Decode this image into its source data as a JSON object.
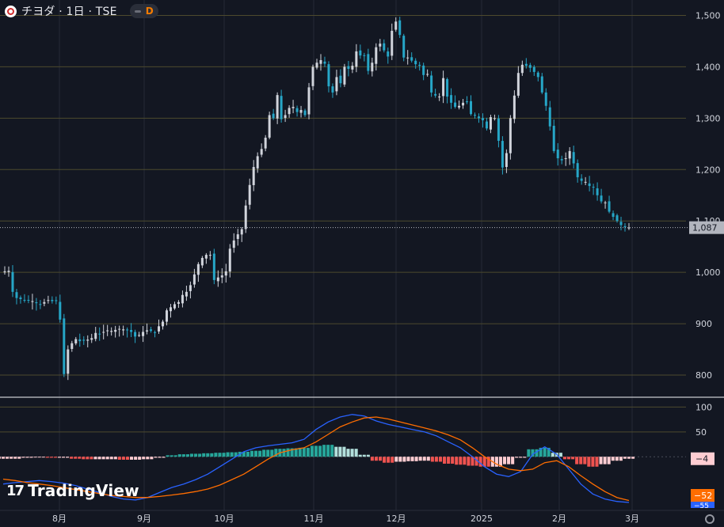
{
  "header": {
    "title": "チヨダ · 1日 · TSE",
    "interval_badge": "D"
  },
  "brand": {
    "mark": "17",
    "text": "TradingView"
  },
  "colors": {
    "background": "#131722",
    "grid": "#363a45",
    "gold_grid": "#4d4a2e",
    "up": "#d1d4dc",
    "down": "#26a6c7",
    "macd_line": "#2962ff",
    "signal_line": "#ff6d00",
    "hist_pos": "#26a69a",
    "hist_pos_light": "#b2dfdb",
    "hist_neg": "#ef5350",
    "hist_neg_light": "#ffcdd2",
    "last_price_tag": "#b2b5be",
    "macd_tag": "#f23645",
    "signal_tag": "#ff6d00"
  },
  "chart_data": {
    "type": "candlestick",
    "symbol": "チヨダ",
    "interval": "1日",
    "exchange": "TSE",
    "price_axis": {
      "ticks": [
        800,
        900,
        1000,
        1100,
        1200,
        1300,
        1400,
        1500
      ],
      "tick_labels": [
        "800",
        "900",
        "1,000",
        "1,100",
        "1,200",
        "1,300",
        "1,400",
        "1,500"
      ],
      "range": [
        760,
        1530
      ]
    },
    "time_axis": {
      "labels": [
        "8月",
        "9月",
        "10月",
        "11月",
        "12月",
        "2025",
        "2月",
        "3月"
      ]
    },
    "last_price": 1087,
    "last_price_label": "1,087",
    "candles_close": [
      1002,
      1003,
      962,
      950,
      948,
      946,
      945,
      944,
      940,
      938,
      942,
      946,
      944,
      945,
      908,
      802,
      850,
      862,
      870,
      866,
      867,
      869,
      872,
      882,
      880,
      884,
      887,
      886,
      888,
      890,
      889,
      888,
      884,
      875,
      878,
      884,
      887,
      886,
      883,
      895,
      904,
      926,
      932,
      938,
      942,
      956,
      962,
      975,
      996,
      1016,
      1028,
      1034,
      1034,
      985,
      990,
      994,
      1002,
      1046,
      1062,
      1074,
      1084,
      1130,
      1170,
      1205,
      1226,
      1240,
      1262,
      1306,
      1300,
      1345,
      1298,
      1306,
      1320,
      1322,
      1312,
      1316,
      1306,
      1360,
      1400,
      1408,
      1413,
      1406,
      1362,
      1350,
      1380,
      1368,
      1400,
      1396,
      1402,
      1430,
      1422,
      1422,
      1392,
      1408,
      1438,
      1445,
      1432,
      1420,
      1470,
      1488,
      1462,
      1418,
      1418,
      1412,
      1405,
      1402,
      1384,
      1386,
      1350,
      1344,
      1342,
      1378,
      1342,
      1330,
      1322,
      1324,
      1330,
      1332,
      1308,
      1306,
      1300,
      1296,
      1280,
      1302,
      1300,
      1256,
      1204,
      1232,
      1300,
      1344,
      1388,
      1404,
      1402,
      1398,
      1390,
      1380,
      1350,
      1324,
      1284,
      1236,
      1222,
      1218,
      1222,
      1236,
      1212,
      1185,
      1178,
      1176,
      1168,
      1165,
      1150,
      1138,
      1136,
      1118,
      1108,
      1100,
      1092,
      1088,
      1087
    ],
    "macd": {
      "values": [
        -55,
        -52,
        -50,
        -48,
        -50,
        -53,
        -58,
        -65,
        -72,
        -80,
        -85,
        -87,
        -82,
        -72,
        -62,
        -55,
        -46,
        -35,
        -20,
        -5,
        10,
        18,
        22,
        25,
        28,
        35,
        55,
        70,
        80,
        85,
        82,
        72,
        65,
        60,
        55,
        50,
        42,
        30,
        18,
        0,
        -20,
        -35,
        -40,
        -30,
        5,
        20,
        5,
        -25,
        -55,
        -75,
        -85,
        -90,
        -92
      ],
      "signal": [
        -45,
        -48,
        -52,
        -55,
        -58,
        -62,
        -66,
        -70,
        -74,
        -78,
        -80,
        -82,
        -82,
        -80,
        -77,
        -74,
        -70,
        -65,
        -57,
        -46,
        -35,
        -20,
        -5,
        8,
        14,
        18,
        30,
        45,
        60,
        70,
        78,
        80,
        76,
        70,
        64,
        58,
        52,
        44,
        34,
        18,
        0,
        -15,
        -25,
        -28,
        -25,
        -12,
        -8,
        -20,
        -38,
        -55,
        -70,
        -82,
        -88
      ],
      "histogram": [
        -4,
        -4,
        -2,
        -1,
        -2,
        -2,
        -4,
        -5,
        -5,
        -5,
        -6,
        -6,
        -5,
        -2,
        3,
        5,
        6,
        7,
        8,
        9,
        10,
        12,
        14,
        16,
        17,
        18,
        22,
        24,
        20,
        16,
        4,
        -8,
        -12,
        -10,
        -9,
        -8,
        -10,
        -14,
        -16,
        -18,
        -20,
        -20,
        -15,
        -2,
        15,
        18,
        8,
        -5,
        -15,
        -20,
        -15,
        -8,
        -4
      ],
      "ticks": [
        100,
        50
      ],
      "range": [
        -100,
        115
      ],
      "tags": {
        "histogram": "−4",
        "macd": "−52",
        "signal": "−55"
      }
    }
  }
}
